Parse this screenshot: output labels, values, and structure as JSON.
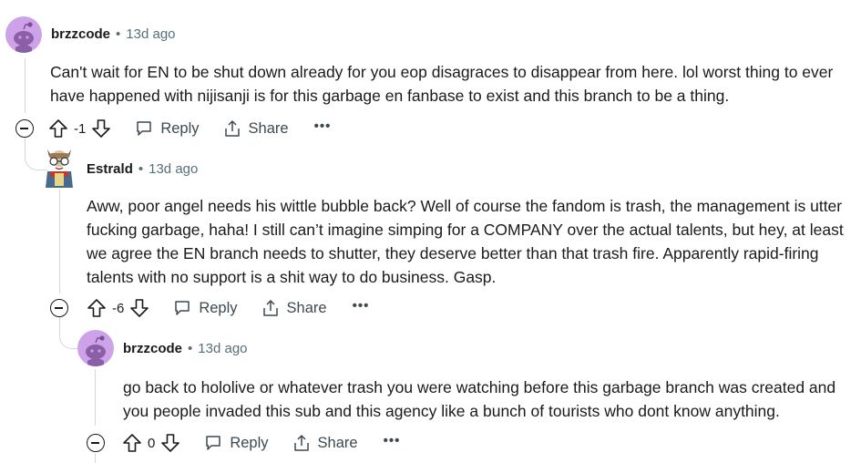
{
  "comments": [
    {
      "author": "brzzcode",
      "separator": "•",
      "time": "13d ago",
      "body": "Can't wait for EN to be shut down already for you eop disagraces to disappear from here. lol worst thing to ever have happened with nijisanji is for this garbage en fanbase to exist and this branch to be a thing.",
      "score": "-1",
      "reply_label": "Reply",
      "share_label": "Share",
      "more_label": "•••",
      "avatar": "reddit-snoo-default-purple"
    },
    {
      "author": "Estrald",
      "separator": "•",
      "time": "13d ago",
      "body": "Aww, poor angel needs his wittle bubble back? Well of course the fandom is trash, the management is utter fucking garbage, haha! I still can’t imagine simping for a COMPANY over the actual talents, but hey, at least we agree the EN branch needs to shutter, they deserve better than that trash fire. Apparently rapid-firing talents with no support is a shit way to do business. Gasp.",
      "score": "-6",
      "reply_label": "Reply",
      "share_label": "Share",
      "more_label": "•••",
      "avatar": "custom-snoo-avatar"
    },
    {
      "author": "brzzcode",
      "separator": "•",
      "time": "13d ago",
      "body": "go back to hololive or whatever trash you were watching before this garbage branch was created and you people invaded this sub and this agency like a bunch of tourists who dont know anything.",
      "score": "0",
      "reply_label": "Reply",
      "share_label": "Share",
      "more_label": "•••",
      "avatar": "reddit-snoo-default-purple"
    }
  ],
  "colors": {
    "text": "#1a1a1b",
    "meta": "#576f76",
    "rail": "#d0d7de",
    "avatar_bg": "#cda2e8"
  }
}
